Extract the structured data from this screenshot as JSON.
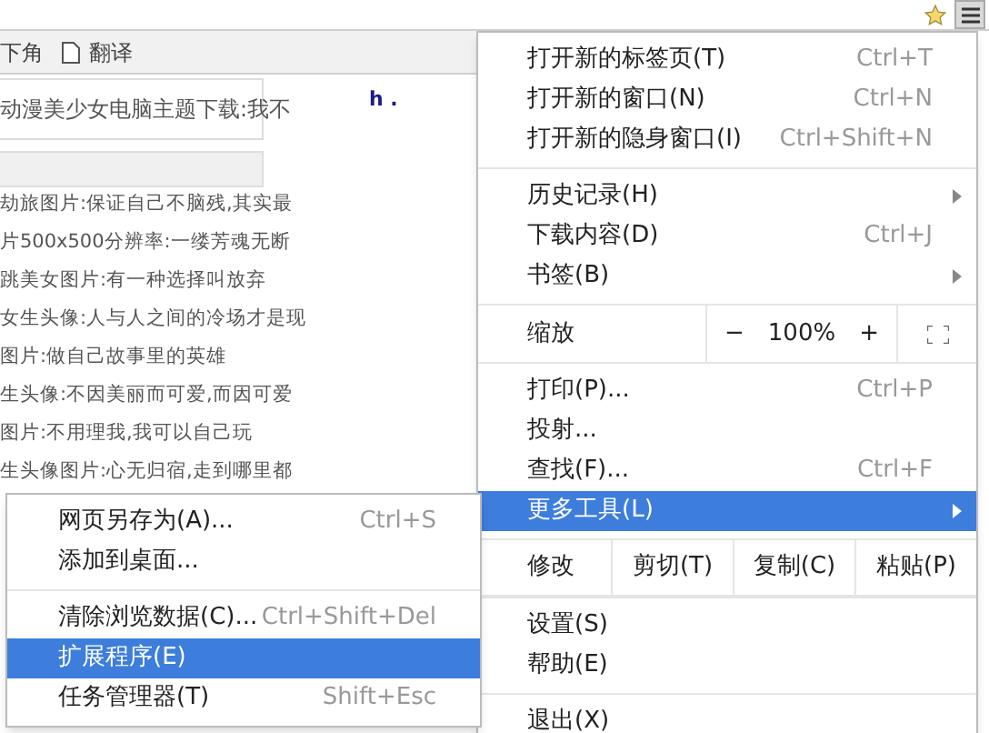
{
  "bookmarks_bar": [
    {
      "kind": "text",
      "label": "下角"
    },
    {
      "kind": "page",
      "label": "翻译"
    }
  ],
  "page": {
    "marker": "h .",
    "top_box_line": "动漫美少女电脑主题下载:我不",
    "list_items": [
      "劫旅图片:保证自己不脑残,其实最",
      "片500x500分辨率:一缕芳魂无断",
      "跳美女图片:有一种选择叫放弃",
      "女生头像:人与人之间的冷场才是现",
      "图片:做自己故事里的英雄",
      "生头像:不因美丽而可爱,而因可爱",
      "图片:不用理我,我可以自己玩",
      "生头像图片:心无归宿,走到哪里都"
    ]
  },
  "menu": {
    "sections": [
      {
        "kind": "items",
        "items": [
          {
            "label": "打开新的标签页(T)",
            "shortcut": "Ctrl+T",
            "submenu": false,
            "selected": false
          },
          {
            "label": "打开新的窗口(N)",
            "shortcut": "Ctrl+N",
            "submenu": false,
            "selected": false
          },
          {
            "label": "打开新的隐身窗口(I)",
            "shortcut": "Ctrl+Shift+N",
            "submenu": false,
            "selected": false
          }
        ]
      },
      {
        "kind": "items",
        "items": [
          {
            "label": "历史记录(H)",
            "submenu": true,
            "selected": false
          },
          {
            "label": "下载内容(D)",
            "shortcut": "Ctrl+J",
            "submenu": false,
            "selected": false
          },
          {
            "label": "书签(B)",
            "submenu": true,
            "selected": false
          }
        ]
      },
      {
        "kind": "zoom",
        "label": "缩放",
        "minus": "−",
        "value": "100%",
        "plus": "+"
      },
      {
        "kind": "items",
        "items": [
          {
            "label": "打印(P)...",
            "shortcut": "Ctrl+P",
            "submenu": false,
            "selected": false
          },
          {
            "label": "投射...",
            "submenu": false,
            "selected": false
          },
          {
            "label": "查找(F)...",
            "shortcut": "Ctrl+F",
            "submenu": false,
            "selected": false
          },
          {
            "label": "更多工具(L)",
            "submenu": true,
            "selected": true
          }
        ]
      },
      {
        "kind": "edit",
        "label": "修改",
        "buttons": [
          "剪切(T)",
          "复制(C)",
          "粘贴(P)"
        ]
      },
      {
        "kind": "items",
        "items": [
          {
            "label": "设置(S)",
            "submenu": false,
            "selected": false
          },
          {
            "label": "帮助(E)",
            "submenu": false,
            "selected": false
          }
        ]
      },
      {
        "kind": "items",
        "items": [
          {
            "label": "退出(X)",
            "submenu": false,
            "selected": false
          }
        ]
      }
    ]
  },
  "submenu": {
    "sections": [
      {
        "kind": "items",
        "items": [
          {
            "label": "网页另存为(A)...",
            "shortcut": "Ctrl+S",
            "submenu": false,
            "selected": false
          },
          {
            "label": "添加到桌面...",
            "submenu": false,
            "selected": false
          }
        ]
      },
      {
        "kind": "items",
        "items": [
          {
            "label": "清除浏览数据(C)...",
            "shortcut": "Ctrl+Shift+Del",
            "submenu": false,
            "selected": false
          },
          {
            "label": "扩展程序(E)",
            "submenu": false,
            "selected": true
          },
          {
            "label": "任务管理器(T)",
            "shortcut": "Shift+Esc",
            "submenu": false,
            "selected": false
          }
        ]
      }
    ]
  }
}
